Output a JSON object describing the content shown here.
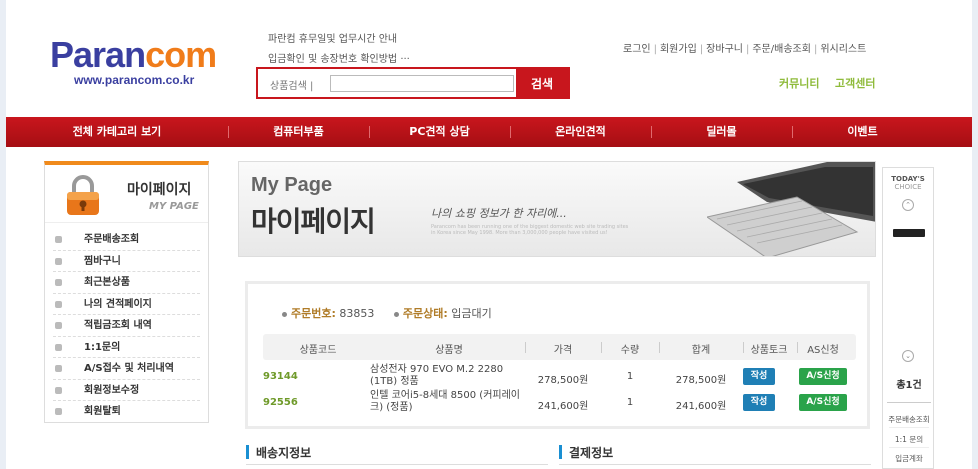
{
  "header": {
    "logo_part1": "Paran",
    "logo_part2": "com",
    "logo_url": "www.parancom.co.kr",
    "notice1": "파란컴 휴무일및 업무시간 안내",
    "notice2": "입금확인 및 송장번호 확인방법 ···",
    "search_label": "상품검색 |",
    "search_value": "",
    "search_button": "검색",
    "top_links": [
      "로그인",
      "회원가입",
      "장바구니",
      "주문/배송조회",
      "위시리스트"
    ],
    "community": "커뮤니티",
    "customer_center": "고객센터"
  },
  "main_nav": [
    "전체 카테고리 보기",
    "컴퓨터부품",
    "PC견적 상담",
    "온라인견적",
    "딜러몰",
    "이벤트"
  ],
  "sidebar": {
    "title": "마이페이지",
    "subtitle": "MY PAGE",
    "items": [
      "주문배송조회",
      "찜바구니",
      "최근본상품",
      "나의 견적페이지",
      "적립금조회 내역",
      "1:1문의",
      "A/S접수 및 처리내역",
      "회원정보수정",
      "회원탈퇴"
    ]
  },
  "banner": {
    "en_title": "My Page",
    "ko_title": "마이페이지",
    "tagline": "나의 쇼핑 정보가 한 자리에...",
    "fine_print": "Parancom has been running one of the biggest domestic web site trading sites in Korea since May 1998. More than 3,000,000 people have visited us!"
  },
  "order": {
    "order_no_label": "주문번호:",
    "order_no": "83853",
    "status_label": "주문상태:",
    "status": "입금대기",
    "columns": [
      "상품코드",
      "상품명",
      "가격",
      "수량",
      "합계",
      "상품토크",
      "AS신청"
    ],
    "rows": [
      {
        "code": "93144",
        "name": "삼성전자 970 EVO M.2 2280 (1TB) 정품",
        "price": "278,500원",
        "qty": "1",
        "total": "278,500원",
        "talk": "작성",
        "as": "A/S신청"
      },
      {
        "code": "92556",
        "name": "인텔 코어i5-8세대 8500 (커피레이크) (정품)",
        "price": "241,600원",
        "qty": "1",
        "total": "241,600원",
        "talk": "작성",
        "as": "A/S신청"
      }
    ]
  },
  "sections": {
    "shipping": "배송지정보",
    "payment": "결제정보"
  },
  "today_choice": {
    "line1": "TODAY'S",
    "line2": "CHOICE",
    "count": "총1건",
    "links": [
      "주문배송조회",
      "1:1 문의",
      "입금계좌"
    ]
  },
  "colors": {
    "brand_red": "#c8161d",
    "brand_blue": "#3a3fa0",
    "brand_orange": "#f07c1a",
    "green_link": "#8fbb3b",
    "talk_button": "#1f7fb5",
    "as_button": "#2aa34a"
  }
}
